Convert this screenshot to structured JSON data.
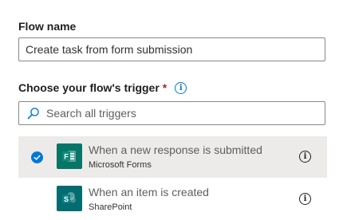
{
  "flow_name": {
    "label": "Flow name",
    "value": "Create task from form submission"
  },
  "trigger": {
    "label": "Choose your flow's trigger",
    "required_marker": "*",
    "info_glyph": "i",
    "search_placeholder": "Search all triggers",
    "items": [
      {
        "title": "When a new response is submitted",
        "app": "Microsoft Forms",
        "selected": true,
        "icon": "microsoft-forms-icon",
        "icon_color": "#077568",
        "info_glyph": "i"
      },
      {
        "title": "When an item is created",
        "app": "SharePoint",
        "selected": false,
        "icon": "sharepoint-icon",
        "icon_color": "#036c70",
        "info_glyph": "i"
      }
    ]
  },
  "colors": {
    "accent": "#0078d4",
    "selected_row": "#edebe9",
    "required": "#a4262c"
  }
}
